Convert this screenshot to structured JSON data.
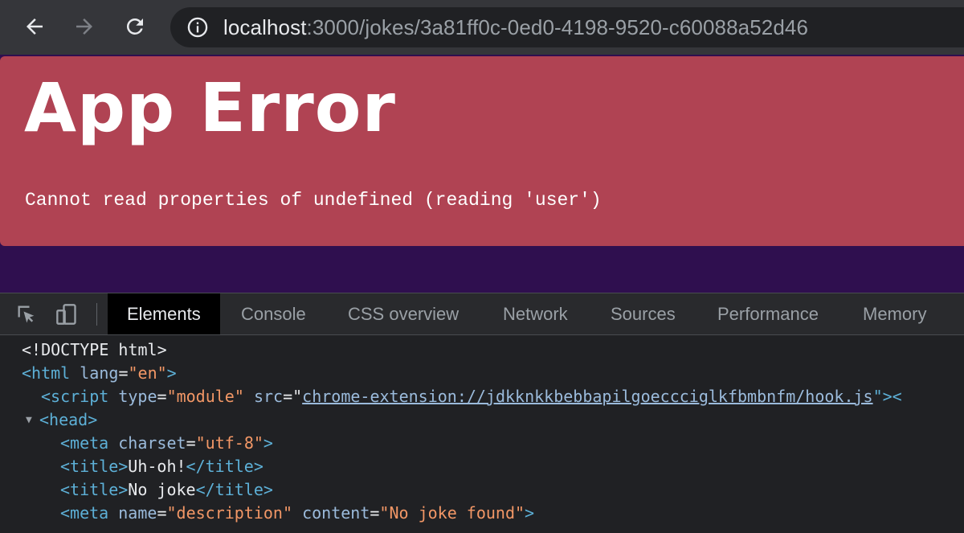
{
  "browser": {
    "url_host": "localhost",
    "url_path": ":3000/jokes/3a81ff0c-0ed0-4198-9520-c60088a52d46"
  },
  "page": {
    "error_title": "App Error",
    "error_message": "Cannot read properties of undefined (reading 'user')",
    "colors": {
      "error_bg": "#b04353",
      "page_bg": "#2f0f4f"
    }
  },
  "devtools": {
    "tabs": [
      {
        "label": "Elements",
        "active": true
      },
      {
        "label": "Console",
        "active": false
      },
      {
        "label": "CSS overview",
        "active": false
      },
      {
        "label": "Network",
        "active": false
      },
      {
        "label": "Sources",
        "active": false
      },
      {
        "label": "Performance",
        "active": false
      },
      {
        "label": "Memory",
        "active": false
      }
    ],
    "dom": {
      "doctype": "<!DOCTYPE html>",
      "html_open": "<html",
      "html_lang_attr": "lang",
      "html_lang_val": "\"en\"",
      "html_close_bracket": ">",
      "script_open": "<script",
      "script_type_attr": "type",
      "script_type_val": "\"module\"",
      "script_src_attr": "src",
      "script_src_val": "chrome-extension://jdkknkkbebbapilgoeccciglkfbmbnfm/hook.js",
      "script_tail": "\"><",
      "head_open": "<head>",
      "meta1_open": "<meta",
      "meta1_attr": "charset",
      "meta1_val": "\"utf-8\"",
      "meta1_close": ">",
      "title1_open": "<title>",
      "title1_text": "Uh-oh!",
      "title1_close": "</title>",
      "title2_open": "<title>",
      "title2_text": "No joke",
      "title2_close": "</title>",
      "meta2_open": "<meta",
      "meta2_name_attr": "name",
      "meta2_name_val": "\"description\"",
      "meta2_content_attr": "content",
      "meta2_content_val": "\"No joke found\"",
      "meta2_close": ">"
    }
  }
}
